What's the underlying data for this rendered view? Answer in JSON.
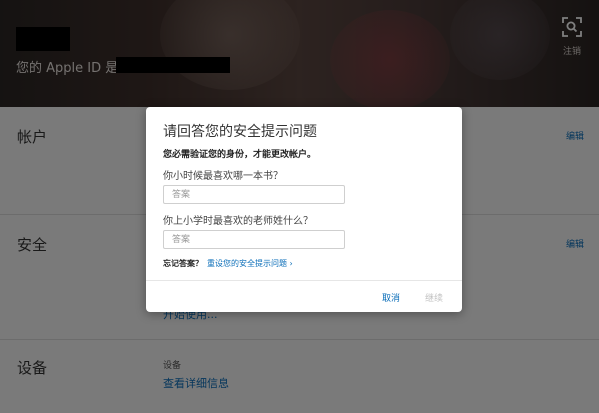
{
  "header": {
    "apple_id_prefix": "您的 Apple ID 是",
    "signout_label": "注销"
  },
  "sections": {
    "account": {
      "title": "帐户",
      "edit_label": "编辑"
    },
    "security": {
      "title": "安全",
      "edit_label": "编辑",
      "partial_link": "开始使用..."
    },
    "devices": {
      "title": "设备",
      "sub_label": "设备",
      "detail_link": "查看详细信息"
    }
  },
  "modal": {
    "title": "请回答您的安全提示问题",
    "subtitle": "您必需验证您的身份，才能更改帐户。",
    "question1": "你小时候最喜欢哪一本书？",
    "answer1_placeholder": "答案",
    "question2": "你上小学时最喜欢的老师姓什么？",
    "answer2_placeholder": "答案",
    "forgot_label": "忘记答案？",
    "reset_link": "重设您的安全提示问题 ›",
    "cancel_label": "取消",
    "continue_label": "继续"
  }
}
